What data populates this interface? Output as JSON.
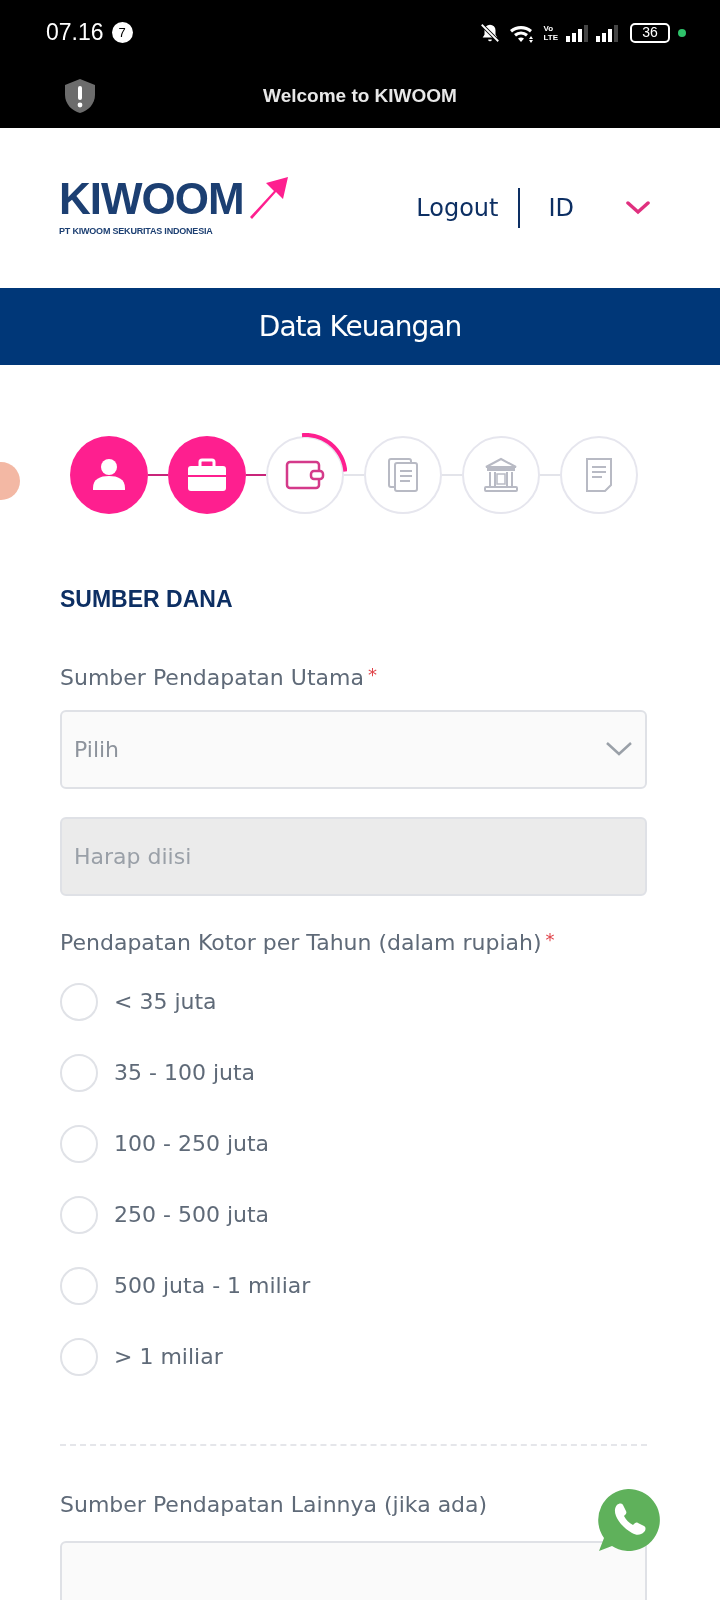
{
  "status_bar": {
    "time": "07.16",
    "notification_count": "7",
    "network_label": [
      "Vo",
      "LTE"
    ],
    "battery": "36"
  },
  "app_bar": {
    "title": "Welcome to KIWOOM"
  },
  "header": {
    "logo_text": "KIWOOM",
    "logo_subtitle": "PT KIWOOM SEKURITAS INDONESIA",
    "logout": "Logout",
    "language": "ID"
  },
  "page_title": "Data Keuangan",
  "steps": [
    {
      "kind": "person",
      "completed": true,
      "current": false
    },
    {
      "kind": "briefcase",
      "completed": true,
      "current": false
    },
    {
      "kind": "wallet",
      "completed": false,
      "current": true
    },
    {
      "kind": "documents",
      "completed": false,
      "current": false
    },
    {
      "kind": "bank",
      "completed": false,
      "current": false
    },
    {
      "kind": "document",
      "completed": false,
      "current": false
    }
  ],
  "section_title": "SUMBER DANA",
  "main_income": {
    "label": "Sumber Pendapatan Utama",
    "required_mark": "*",
    "select_placeholder": "Pilih",
    "input_placeholder": "Harap diisi",
    "input_disabled": true
  },
  "gross_income": {
    "label": "Pendapatan Kotor per Tahun (dalam rupiah)",
    "required_mark": "*",
    "options": [
      {
        "label": "< 35 juta",
        "selected": false
      },
      {
        "label": "35 - 100 juta",
        "selected": false
      },
      {
        "label": "100 - 250 juta",
        "selected": false
      },
      {
        "label": "250 - 500 juta",
        "selected": false
      },
      {
        "label": "500 juta - 1 miliar",
        "selected": false
      },
      {
        "label": "> 1 miliar",
        "selected": false
      }
    ]
  },
  "other_income": {
    "label": "Sumber Pendapatan Lainnya (jika ada)"
  }
}
